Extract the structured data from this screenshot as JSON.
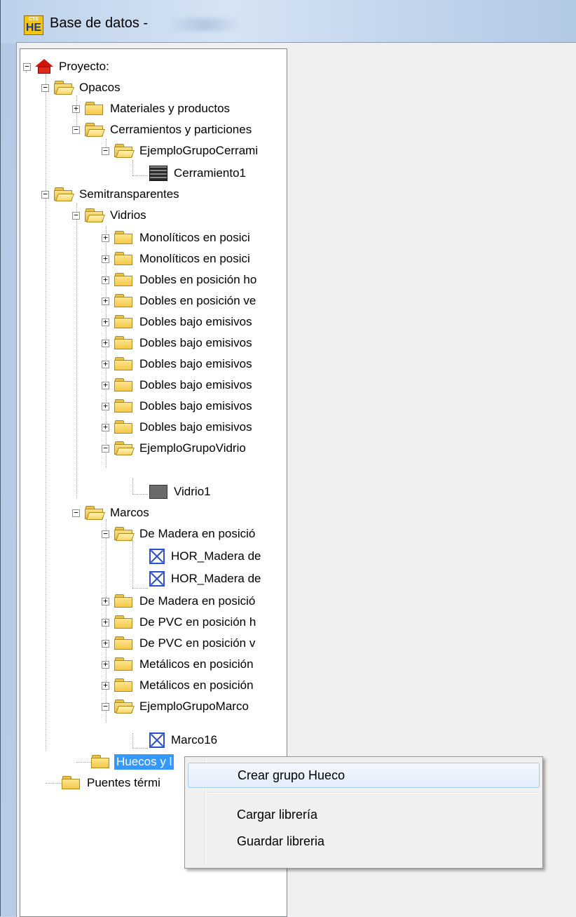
{
  "window": {
    "title": "Base de datos -",
    "icon_top": "CTE",
    "icon_main": "HE"
  },
  "tree": {
    "root": "Proyecto:",
    "opacos": "Opacos",
    "materiales": "Materiales y productos",
    "cerramientos": "Cerramientos y particiones",
    "ejemplo_cerr": "EjemploGrupoCerrami",
    "cerramiento1": "Cerramiento1",
    "semitransparentes": "Semitransparentes",
    "vidrios": "Vidrios",
    "vidrio_groups": [
      "Monolíticos en posici",
      "Monolíticos en posici",
      "Dobles en posición ho",
      "Dobles en posición ve",
      "Dobles bajo emisivos",
      "Dobles bajo emisivos",
      "Dobles bajo emisivos",
      "Dobles bajo emisivos",
      "Dobles bajo emisivos",
      "Dobles bajo emisivos"
    ],
    "ejemplo_vidrio": "EjemploGrupoVidrio",
    "vidrio1": "Vidrio1",
    "marcos": "Marcos",
    "madera_1": "De Madera en posició",
    "hor_madera_1": "HOR_Madera de",
    "hor_madera_2": "HOR_Madera de",
    "marco_groups": [
      "De Madera en posició",
      "De PVC en posición h",
      "De PVC en posición v",
      "Metálicos en posición",
      "Metálicos en posición"
    ],
    "ejemplo_marco": "EjemploGrupoMarco",
    "marco16": "Marco16",
    "huecos": "Huecos y l",
    "puentes": "Puentes térmi"
  },
  "context_menu": {
    "items": [
      "Crear grupo Hueco",
      "Cargar librería",
      "Guardar libreria"
    ]
  },
  "colors": {
    "selection": "#3399ff",
    "menu_hover": "#e3eefb"
  }
}
